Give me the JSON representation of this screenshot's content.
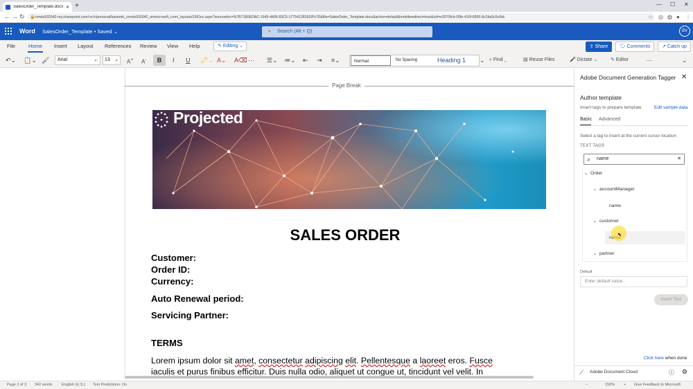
{
  "browser": {
    "tab_title": "SalesOrder_Template.docx",
    "new_tab": "+",
    "url": "crmdx932042-my.sharepoint.com/:w:/r/personal/kanemb_crmdx932042_onmicrosoft_com/_layouts/15/Doc.aspx?sourcedoc=%7B71B0EDAC-1649-4406-83C5-177541281818%7D&file=SalesOrder_Template.docx&action=default&mobileredirect=true&cid=e3070fcb-00fe-416f-8955-8c2da3c5c6dc"
  },
  "header": {
    "app_name": "Word",
    "doc_name": "SalesOrder_Template  •  Saved",
    "search_placeholder": "Search (Alt + Q)",
    "avatar": "BV"
  },
  "ribbon": {
    "menus": [
      "File",
      "Home",
      "Insert",
      "Layout",
      "References",
      "Review",
      "View",
      "Help"
    ],
    "editing": "Editing",
    "share": "Share",
    "comments": "Comments",
    "catchup": "Catch up",
    "font": "Arial",
    "size": "13",
    "bold": "B",
    "italic": "I",
    "underline": "U",
    "styles": [
      "Normal",
      "No Spacing",
      "Heading 1"
    ],
    "find": "Find",
    "reuse_files": "Reuse Files",
    "dictate": "Dictate",
    "editor": "Editor"
  },
  "document": {
    "page_break": "Page Break",
    "banner_logo": "Projected",
    "title": "SALES ORDER",
    "fields": [
      "Customer:",
      "Order ID:",
      "Currency:",
      "Auto Renewal period:",
      "Servicing Partner:"
    ],
    "terms_heading": "TERMS",
    "body_line1_parts": [
      "Lorem ipsum dolor sit ",
      "amet",
      ", ",
      "consectetur",
      " ",
      "adipiscing",
      " ",
      "elit",
      ". ",
      "Pellentesque",
      " a ",
      "laoreet",
      " eros. ",
      "Fusce"
    ],
    "body_line2_parts": [
      "iaculis",
      " et ",
      "purus",
      " finibus ",
      "efficitur",
      ". ",
      "Duis",
      " ",
      "nulla",
      " ",
      "odio",
      ", ",
      "aliquet",
      " ut ",
      "congue",
      " ut, ",
      "tincidunt",
      " ",
      "vel",
      " ",
      "velit",
      ". In"
    ]
  },
  "status_bar": {
    "page": "Page 2 of 3",
    "words": "342 words",
    "language": "English (U.S.)",
    "predictions": "Text Predictions: On",
    "zoom": "150%",
    "feedback": "Give Feedback to Microsoft"
  },
  "panel": {
    "title": "Adobe Document Generation Tagger",
    "author_heading": "Author template",
    "insert_desc": "Insert tags to prepare template",
    "edit_sample": "Edit sample data",
    "tab_basic": "Basic",
    "tab_advanced": "Advanced",
    "select_tag": "Select a tag to insert at the current cursor location",
    "text_tags": "TEXT TAGS",
    "search_value": "name",
    "tree": {
      "order": "Order",
      "account_manager": "accountManager",
      "am_name": "name",
      "customer": "customer",
      "cust_name": "name",
      "partner": "partner"
    },
    "default_label": "Default",
    "default_placeholder": "Enter default value..",
    "insert_text": "Insert Text",
    "click_here": "Click here",
    "when_done": " when done",
    "footer": "Adobe Document Cloud"
  }
}
